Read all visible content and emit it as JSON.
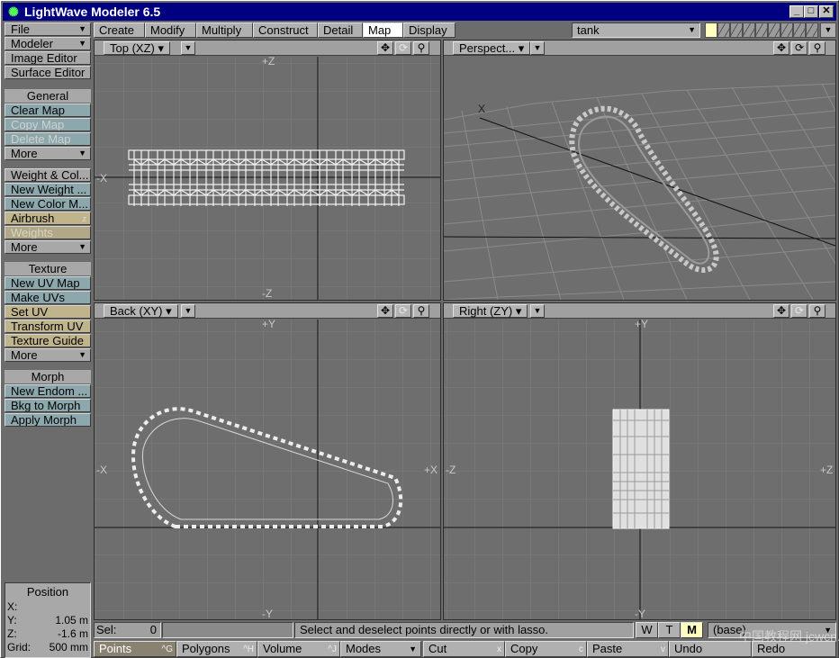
{
  "window": {
    "title": "LightWave Modeler 6.5",
    "min": "_",
    "max": "□",
    "close": "✕"
  },
  "sidebar": {
    "file": "File",
    "modeler": "Modeler",
    "image_editor": "Image Editor",
    "surface_editor": "Surface Editor",
    "general_head": "General",
    "clear_map": "Clear Map",
    "copy_map": "Copy Map",
    "delete_map": "Delete Map",
    "more1": "More",
    "weight_color": "Weight & Col...",
    "new_weight": "New Weight ...",
    "new_color": "New Color M...",
    "airbrush": "Airbrush",
    "airbrush_key": "z",
    "weights": "Weights",
    "more2": "More",
    "texture_head": "Texture",
    "new_uv": "New UV Map",
    "make_uvs": "Make UVs",
    "set_uv": "Set UV",
    "transform_uv": "Transform UV",
    "texture_guide": "Texture Guide",
    "more3": "More",
    "morph_head": "Morph",
    "new_endom": "New Endom ...",
    "bkg_morph": "Bkg to Morph",
    "apply_morph": "Apply Morph"
  },
  "position": {
    "head": "Position",
    "x_label": "X:",
    "x_value": "",
    "y_label": "Y:",
    "y_value": "1.05 m",
    "z_label": "Z:",
    "z_value": "-1.6 m",
    "grid_label": "Grid:",
    "grid_value": "500 mm"
  },
  "tabs": [
    "Create",
    "Modify",
    "Multiply",
    "Construct",
    "Detail",
    "Map",
    "Display"
  ],
  "active_tab": "Map",
  "object": {
    "name": "tank"
  },
  "viewports": {
    "top": {
      "name": "Top   (XZ)",
      "axis_top": "+Z",
      "axis_bottom": "-Z",
      "axis_left": "-X"
    },
    "persp": {
      "name": "Perspect...",
      "axis_x": "X"
    },
    "back": {
      "name": "Back   (XY)",
      "axis_top": "+Y",
      "axis_bottom": "-Y",
      "axis_left": "-X",
      "axis_right": "+X"
    },
    "right": {
      "name": "Right   (ZY)",
      "axis_top": "+Y",
      "axis_bottom": "-Y",
      "axis_left": "-Z",
      "axis_right": "+Z"
    }
  },
  "status": {
    "sel_label": "Sel:",
    "sel_value": "0",
    "message": "Select and deselect points directly or with lasso.",
    "w": "W",
    "t": "T",
    "m": "M",
    "layer": "(base)"
  },
  "bottom": {
    "points": "Points",
    "points_key": "^G",
    "polygons": "Polygons",
    "polygons_key": "^H",
    "volume": "Volume",
    "volume_key": "^J",
    "modes": "Modes",
    "cut": "Cut",
    "cut_key": "x",
    "copy": "Copy",
    "copy_key": "c",
    "paste": "Paste",
    "paste_key": "v",
    "undo": "Undo",
    "redo": "Redo"
  },
  "watermark": "中国教程网 jcwcn.com"
}
